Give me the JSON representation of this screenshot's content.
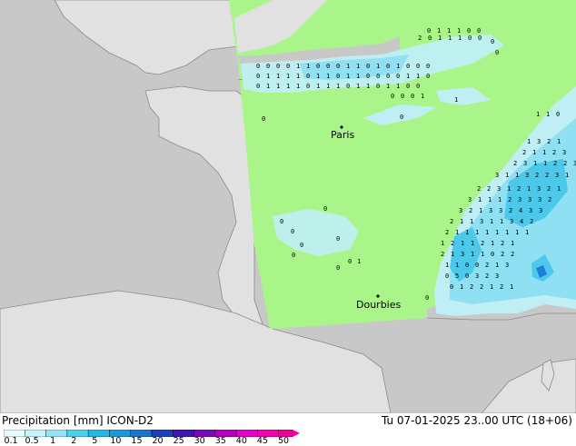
{
  "title_left": "Precipitation [mm]  ICON-D2",
  "title_right": "Tu 07-01-2025 23..00 UTC (18+06)",
  "cities": [
    {
      "name": "Paris"
    },
    {
      "name": "Dourbies"
    }
  ],
  "legend": {
    "ticks": [
      "0.1",
      "0.5",
      "1",
      "2",
      "5",
      "10",
      "15",
      "20",
      "25",
      "30",
      "35",
      "40",
      "45",
      "50"
    ],
    "colors": [
      "#e6fbfd",
      "#c4f3fa",
      "#8fe4f5",
      "#4ccfee",
      "#22b7e6",
      "#1d98da",
      "#1c74cc",
      "#1a3fb8",
      "#3f17b0",
      "#7a0ab5",
      "#b300c0",
      "#e000c9",
      "#f400b0",
      "#f0009a"
    ]
  },
  "colors": {
    "sea": "#c8c8c8",
    "land_outside_domain": "#e1e1e1",
    "model_domain": "#aaf58a",
    "precip_light": "#bfeff4",
    "precip_medium": "#8fe0f2",
    "precip_heavy": "#4cc8ea",
    "precip_max": "#1d7ed8",
    "coastline": "#8a8a8a"
  }
}
